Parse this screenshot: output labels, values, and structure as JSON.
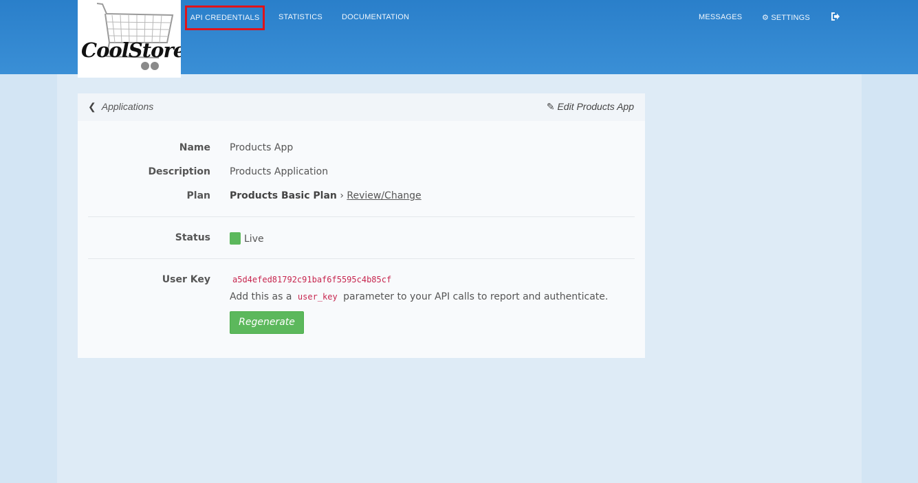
{
  "brand": {
    "logo_text": "CoolStore"
  },
  "nav": {
    "api_credentials": "API CREDENTIALS",
    "statistics": "STATISTICS",
    "documentation": "DOCUMENTATION",
    "messages": "MESSAGES",
    "settings": "SETTINGS"
  },
  "panel": {
    "back_label": "Applications",
    "edit_label": "Edit Products App",
    "fields": {
      "name_label": "Name",
      "name_value": "Products App",
      "description_label": "Description",
      "description_value": "Products Application",
      "plan_label": "Plan",
      "plan_value": "Products Basic Plan",
      "plan_separator": "›",
      "plan_change_link": "Review/Change",
      "status_label": "Status",
      "status_value": "Live",
      "userkey_label": "User Key",
      "userkey_value": "a5d4efed81792c91baf6f5595c4b85cf",
      "hint_before": "Add this as a",
      "hint_code": "user_key",
      "hint_after": "parameter to your API calls to report and authenticate.",
      "regenerate_label": "Regenerate"
    }
  },
  "colors": {
    "header_blue": "#2a7fca",
    "highlight_border": "#e0131a",
    "live_green": "#5cb85c",
    "code_red": "#c7254e"
  }
}
